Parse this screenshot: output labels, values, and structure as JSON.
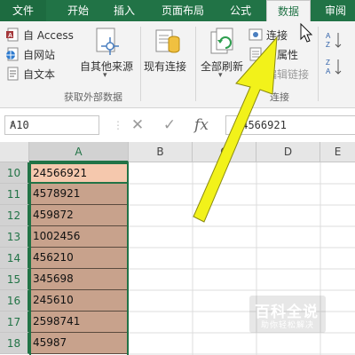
{
  "tabs": {
    "file": "文件",
    "home": "开始",
    "insert": "插入",
    "page_layout": "页面布局",
    "formulas": "公式",
    "data": "数据",
    "review": "审阅"
  },
  "ribbon": {
    "from_access": "自 Access",
    "from_web": "自网站",
    "from_text": "自文本",
    "from_other_sources": "自其他来源",
    "existing_connections": "现有连接",
    "refresh_all": "全部刷新",
    "connections": "连接",
    "properties_partial": "属性",
    "edit_links": "编辑链接",
    "group_get_external": "获取外部数据",
    "group_connections": "连接"
  },
  "formula_bar": {
    "name_box": "A10",
    "cancel_symbol": "✕",
    "enter_symbol": "✓",
    "fx_symbol": "fx",
    "content": "24566921"
  },
  "sheet": {
    "columns": [
      "A",
      "B",
      "C",
      "D",
      "E"
    ],
    "rows": [
      {
        "num": "10",
        "a": "24566921"
      },
      {
        "num": "11",
        "a": "4578921"
      },
      {
        "num": "12",
        "a": "459872"
      },
      {
        "num": "13",
        "a": "1002456"
      },
      {
        "num": "14",
        "a": "456210"
      },
      {
        "num": "15",
        "a": "345698"
      },
      {
        "num": "16",
        "a": "245610"
      },
      {
        "num": "17",
        "a": "2598741"
      },
      {
        "num": "18",
        "a": "45987"
      }
    ]
  },
  "watermark": {
    "title": "百科全说",
    "subtitle": "助你轻松解决"
  },
  "colors": {
    "excel_green": "#217346",
    "selected_fill": "#c8a28c",
    "active_cell_fill": "#f5c8ad",
    "arrow_yellow": "#f2f21a"
  }
}
